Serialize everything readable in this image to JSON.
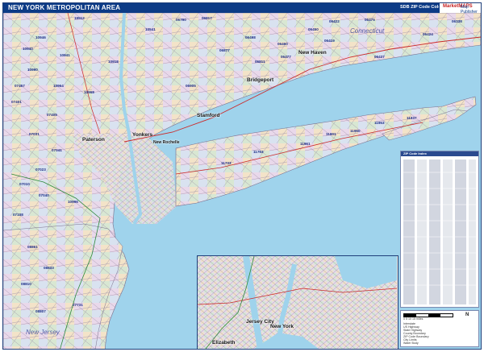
{
  "title": "NEW YORK METROPOLITAN AREA",
  "edition": "SDB ZIP Code Color/Cast Edition",
  "brand": "MarketMAPS",
  "brand_tag": "Map Publisher",
  "colors": {
    "water": "#9fd3ec",
    "title_bar": "#0d3b86",
    "zip_text": "#1d2f88",
    "road": "#cc2a2a"
  },
  "place_labels": {
    "connecticut": "Connecticut",
    "new_haven": "New Haven",
    "bridgeport": "Bridgeport",
    "stamford": "Stamford",
    "paterson": "Paterson",
    "yonkers": "Yonkers",
    "new_rochelle": "New Rochelle",
    "new_jersey": "New Jersey",
    "jersey_city": "Jersey City",
    "new_york": "New York",
    "elizabeth": "Elizabeth"
  },
  "zip_labels": [
    "19512",
    "10946",
    "10940",
    "10941",
    "06790",
    "06817",
    "06475",
    "06422",
    "06338",
    "06424",
    "10990",
    "10964",
    "10968",
    "06460",
    "06419",
    "06877",
    "06905",
    "06498",
    "06811",
    "06477",
    "06450",
    "10918",
    "07031",
    "06437",
    "07405",
    "11950",
    "11763",
    "11937",
    "11901",
    "11961",
    "07023",
    "07010",
    "10996",
    "11953",
    "07108",
    "08861",
    "08833",
    "08810",
    "07731",
    "08807",
    "07401",
    "07041",
    "07040",
    "07457",
    "10541",
    "11733"
  ],
  "index_header": "ZIP Code Index",
  "legend": {
    "scale_label": "0 5 10 15 miles",
    "north_label": "N",
    "rows": [
      "Interstate",
      "US Highway",
      "State Highway",
      "County Boundary",
      "ZIP Code Boundary",
      "City Limits",
      "Water Body"
    ]
  }
}
